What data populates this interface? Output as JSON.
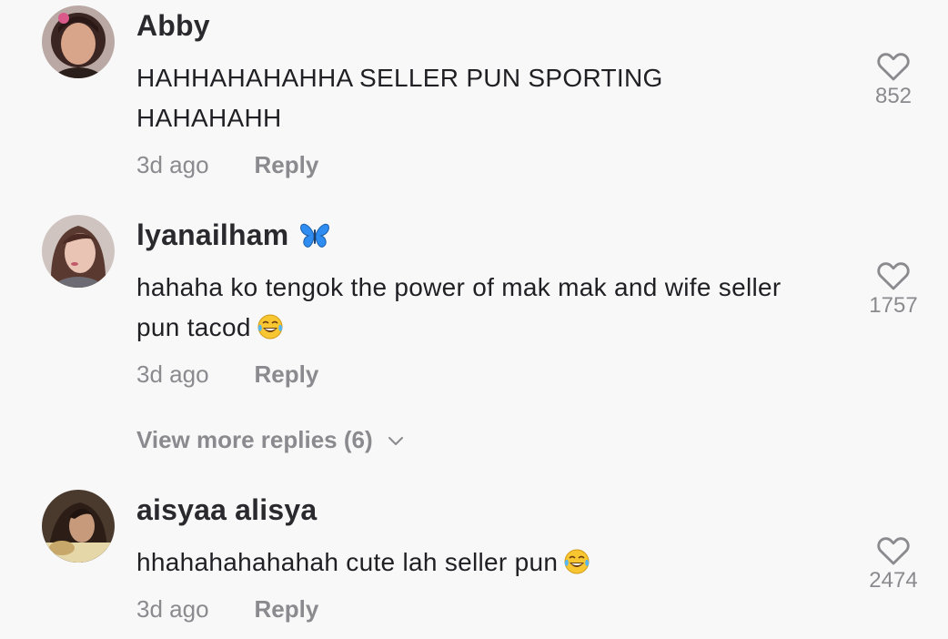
{
  "comments": [
    {
      "username": "Abby",
      "text": "HAHHAHAHAHHA SELLER PUN SPORTING HAHAHAHH",
      "time": "3d ago",
      "reply_label": "Reply",
      "likes": "852"
    },
    {
      "username": "lyanailham",
      "text": "hahaha ko tengok the power of mak mak and wife seller pun tacod",
      "time": "3d ago",
      "reply_label": "Reply",
      "likes": "1757"
    },
    {
      "username": "aisyaa alisya",
      "text": "hhahahahahahah cute lah seller pun",
      "time": "3d ago",
      "reply_label": "Reply",
      "likes": "2474"
    }
  ],
  "view_more_replies": "View more replies (6)",
  "icons": {
    "like": "heart-outline-icon",
    "expand": "chevron-down-icon",
    "badge": "blue-butterfly-emoji",
    "reaction": "tears-of-joy-emoji"
  },
  "colors": {
    "background": "#f8f8f8",
    "username": "#2a2a2e",
    "muted": "#8a8a8f",
    "butterfly": "#2f8cf0",
    "emoji": "#f7c631"
  }
}
